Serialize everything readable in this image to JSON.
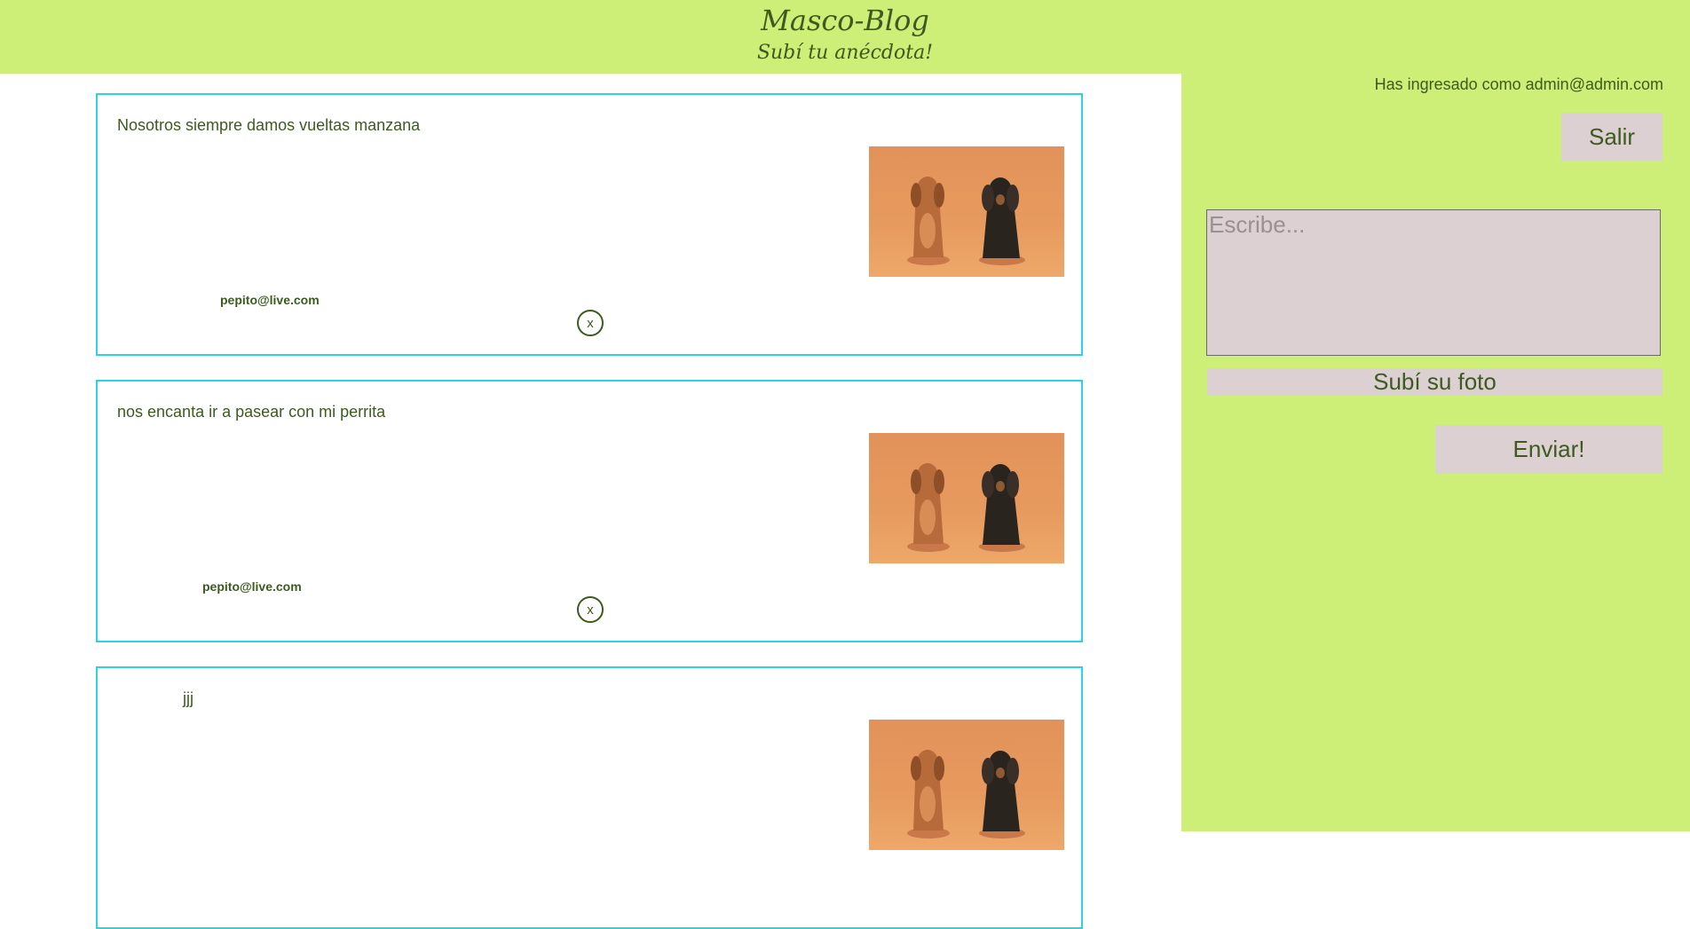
{
  "header": {
    "title": "Masco-Blog",
    "subtitle": "Subí tu anécdota!"
  },
  "sidebar": {
    "logged_in_text": "Has ingresado como admin@admin.com",
    "logout_label": "Salir",
    "textarea_placeholder": "Escribe...",
    "upload_label": "Subí su foto",
    "send_label": "Enviar!"
  },
  "posts": [
    {
      "text": "Nosotros siempre damos vueltas manzana",
      "author": "pepito@live.com",
      "delete_label": "x",
      "photo_icon": "dachshunds-photo"
    },
    {
      "text": "nos encanta ir a pasear con mi perrita",
      "author": "pepito@live.com",
      "delete_label": "x",
      "photo_icon": "dachshunds-photo"
    },
    {
      "text": "jjj",
      "photo_icon": "dachshunds-photo"
    }
  ],
  "colors": {
    "accent_green": "#cdef78",
    "text_green": "#3d5a1f",
    "post_border": "#2ad4e0",
    "button_bg": "#dcd0d3"
  }
}
